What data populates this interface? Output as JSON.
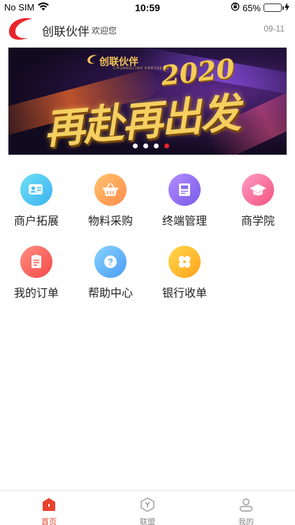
{
  "status_bar": {
    "carrier": "No SIM",
    "time": "10:59",
    "battery_percent": "65%",
    "battery_level": 0.65
  },
  "header": {
    "app_name": "创联伙伴",
    "welcome": "欢迎您",
    "date": "09-11"
  },
  "banner": {
    "brand": "创联伙伴",
    "brand_sub": "CHUANGLIAN PARTNERS",
    "year": "2020",
    "slogan": "再赴再出发",
    "dot_count": 4,
    "active_dot": 4
  },
  "menu": {
    "items": [
      {
        "label": "商户拓展",
        "icon": "merchant-icon",
        "color": "#3bb2f0"
      },
      {
        "label": "物料采购",
        "icon": "basket-icon",
        "color": "#ff8a4e"
      },
      {
        "label": "终端管理",
        "icon": "terminal-icon",
        "color": "#7a5ae8"
      },
      {
        "label": "商学院",
        "icon": "graduation-cap-icon",
        "color": "#f3527f"
      },
      {
        "label": "我的订单",
        "icon": "order-icon",
        "color": "#f5484a"
      },
      {
        "label": "帮助中心",
        "icon": "help-icon",
        "color": "#4a9cf5"
      },
      {
        "label": "银行收单",
        "icon": "clover-icon",
        "color": "#ffa31a"
      }
    ]
  },
  "tabbar": {
    "tabs": [
      {
        "label": "首页",
        "icon": "home-icon",
        "active": true
      },
      {
        "label": "联盟",
        "icon": "alliance-icon",
        "active": false
      },
      {
        "label": "我的",
        "icon": "profile-icon",
        "active": false
      }
    ]
  },
  "colors": {
    "accent": "#e8412e",
    "active_dot": "#e5262b"
  }
}
